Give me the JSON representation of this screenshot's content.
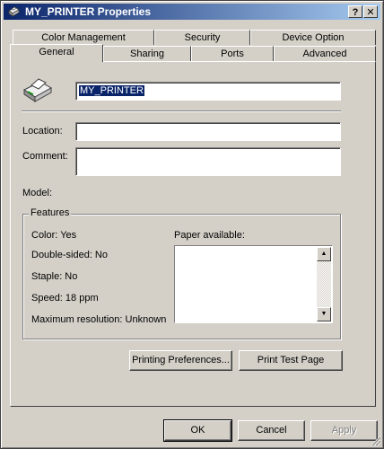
{
  "window": {
    "title": "MY_PRINTER Properties",
    "help_button": "?",
    "close_button": "✕"
  },
  "tabs": {
    "back_row": [
      "Color Management",
      "Security",
      "Device Option"
    ],
    "front_row": [
      "General",
      "Sharing",
      "Ports",
      "Advanced"
    ],
    "active": "General"
  },
  "general": {
    "printer_name": "MY_PRINTER",
    "location_label": "Location:",
    "location_value": "",
    "comment_label": "Comment:",
    "comment_value": "",
    "model_label": "Model:",
    "model_value": ""
  },
  "features": {
    "title": "Features",
    "color": "Color: Yes",
    "double_sided": "Double-sided: No",
    "staple": "Staple: No",
    "speed": "Speed: 18 ppm",
    "max_resolution": "Maximum resolution: Unknown",
    "paper_available_label": "Paper available:",
    "paper_list": []
  },
  "buttons": {
    "printing_preferences": "Printing Preferences...",
    "print_test_page": "Print Test Page",
    "ok": "OK",
    "cancel": "Cancel",
    "apply": "Apply"
  },
  "icons": {
    "title_icon": "printer-icon",
    "printer_icon": "printer-icon"
  },
  "colors": {
    "title_gradient_start": "#0a246a",
    "title_gradient_end": "#a6caf0",
    "face": "#d4d0c8",
    "selection": "#0a246a"
  }
}
